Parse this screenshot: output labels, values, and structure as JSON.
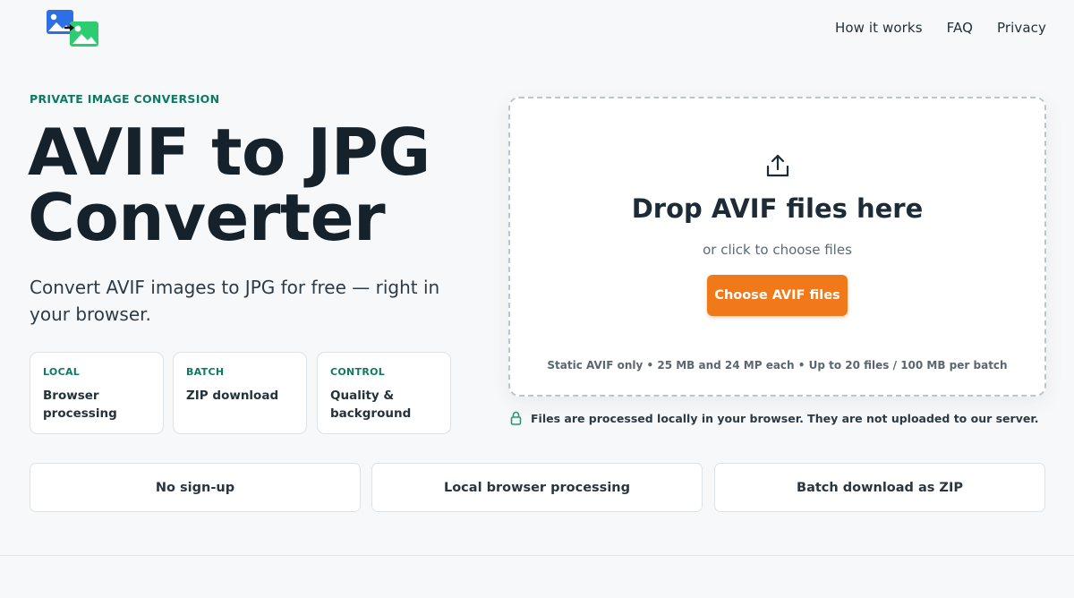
{
  "header": {
    "logo_icon": "image-convert-logo-icon",
    "nav": [
      "How it works",
      "FAQ",
      "Privacy"
    ]
  },
  "hero": {
    "eyebrow": "PRIVATE IMAGE CONVERSION",
    "title_line1": "AVIF to JPG",
    "title_line2": "Converter",
    "subtitle": "Convert AVIF images to JPG for free — right in your browser.",
    "features": [
      {
        "tag": "LOCAL",
        "text": "Browser processing"
      },
      {
        "tag": "BATCH",
        "text": "ZIP download"
      },
      {
        "tag": "CONTROL",
        "text": "Quality & background"
      }
    ]
  },
  "dropzone": {
    "icon": "upload-icon",
    "title": "Drop AVIF files here",
    "subtitle": "or click to choose files",
    "button_label": "Choose AVIF files",
    "limits": "Static AVIF only • 25 MB and 24 MP each • Up to 20 files / 100 MB per batch"
  },
  "privacy_note": "Files are processed locally in your browser. They are not uploaded to our server.",
  "benefits": [
    "No sign-up",
    "Local browser processing",
    "Batch download as ZIP"
  ],
  "colors": {
    "accent_orange": "#f07a1a",
    "accent_green": "#0f7a62",
    "background": "#f7f8fa",
    "logo_blue": "#2f6fe4",
    "logo_green": "#2ecc71"
  }
}
